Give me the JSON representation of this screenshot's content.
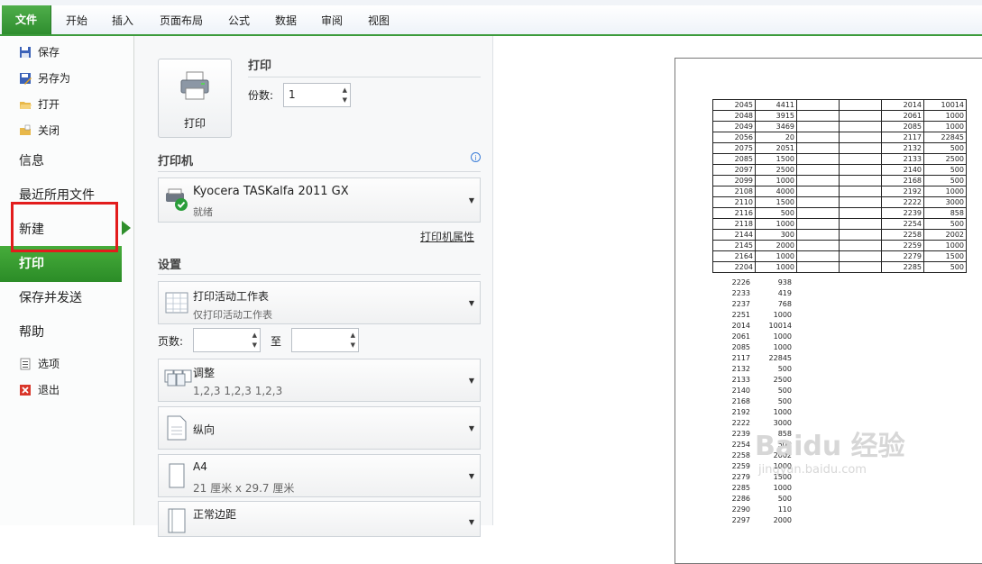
{
  "ribbon": {
    "file_tab": "文件",
    "tabs": [
      "开始",
      "插入",
      "页面布局",
      "公式",
      "数据",
      "审阅",
      "视图"
    ]
  },
  "nav": {
    "save": "保存",
    "save_as": "另存为",
    "open": "打开",
    "close": "关闭",
    "info": "信息",
    "recent": "最近所用文件",
    "new": "新建",
    "print": "打印",
    "save_send": "保存并发送",
    "help": "帮助",
    "options": "选项",
    "exit": "退出"
  },
  "print_panel": {
    "title": "打印",
    "print_button": "打印",
    "copies_label": "份数:",
    "copies_value": "1",
    "printer_section": "打印机",
    "printer_name": "Kyocera TASKalfa 2011 GX",
    "printer_status": "就绪",
    "printer_properties": "打印机属性",
    "settings_section": "设置",
    "setting_scope_main": "打印活动工作表",
    "setting_scope_sub": "仅打印活动工作表",
    "pages_label": "页数:",
    "pages_to": "至",
    "collate_main": "调整",
    "collate_sub": "1,2,3    1,2,3    1,2,3",
    "orientation": "纵向",
    "paper_main": "A4",
    "paper_sub": "21 厘米 x 29.7 厘米",
    "margins_main": "正常边距"
  },
  "preview": {
    "table_rows": [
      [
        "2045",
        "4411",
        "",
        "",
        "2014",
        "10014"
      ],
      [
        "2048",
        "3915",
        "",
        "",
        "2061",
        "1000"
      ],
      [
        "2049",
        "3469",
        "",
        "",
        "2085",
        "1000"
      ],
      [
        "2056",
        "20",
        "",
        "",
        "2117",
        "22845"
      ],
      [
        "2075",
        "2051",
        "",
        "",
        "2132",
        "500"
      ],
      [
        "2085",
        "1500",
        "",
        "",
        "2133",
        "2500"
      ],
      [
        "2097",
        "2500",
        "",
        "",
        "2140",
        "500"
      ],
      [
        "2099",
        "1000",
        "",
        "",
        "2168",
        "500"
      ],
      [
        "2108",
        "4000",
        "",
        "",
        "2192",
        "1000"
      ],
      [
        "2110",
        "1500",
        "",
        "",
        "2222",
        "3000"
      ],
      [
        "2116",
        "500",
        "",
        "",
        "2239",
        "858"
      ],
      [
        "2118",
        "1000",
        "",
        "",
        "2254",
        "500"
      ],
      [
        "2144",
        "300",
        "",
        "",
        "2258",
        "2002"
      ],
      [
        "2145",
        "2000",
        "",
        "",
        "2259",
        "1000"
      ],
      [
        "2164",
        "1000",
        "",
        "",
        "2279",
        "1500"
      ],
      [
        "2204",
        "1000",
        "",
        "",
        "2285",
        "500"
      ]
    ],
    "list_rows": [
      [
        "2226",
        "938"
      ],
      [
        "2233",
        "419"
      ],
      [
        "2237",
        "768"
      ],
      [
        "2251",
        "1000"
      ],
      [
        "2014",
        "10014"
      ],
      [
        "2061",
        "1000"
      ],
      [
        "2085",
        "1000"
      ],
      [
        "2117",
        "22845"
      ],
      [
        "2132",
        "500"
      ],
      [
        "2133",
        "2500"
      ],
      [
        "2140",
        "500"
      ],
      [
        "2168",
        "500"
      ],
      [
        "2192",
        "1000"
      ],
      [
        "2222",
        "3000"
      ],
      [
        "2239",
        "858"
      ],
      [
        "2254",
        "500"
      ],
      [
        "2258",
        "2002"
      ],
      [
        "2259",
        "1000"
      ],
      [
        "2279",
        "1500"
      ],
      [
        "2285",
        "1000"
      ],
      [
        "2286",
        "500"
      ],
      [
        "2290",
        "110"
      ],
      [
        "2297",
        "2000"
      ]
    ],
    "watermark_main": "Baidu 经验",
    "watermark_sub": "jingyan.baidu.com"
  }
}
